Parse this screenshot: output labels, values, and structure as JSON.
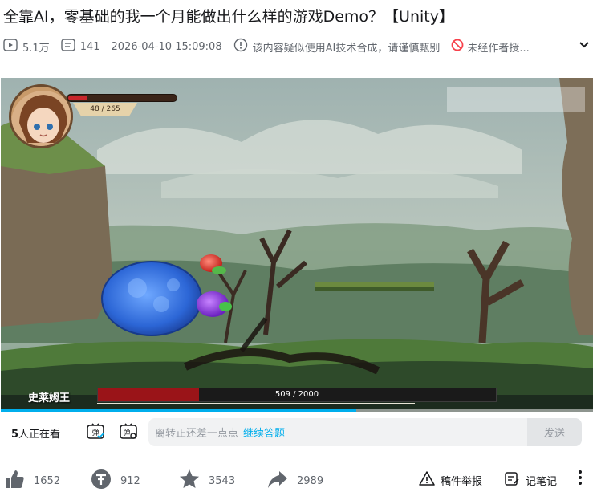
{
  "video": {
    "title": "全靠AI，零基础的我一个月能做出什么样的游戏Demo？【Unity】",
    "views": "5.1万",
    "danmaku_count": "141",
    "publish_time": "2026-04-10 15:09:08",
    "ai_notice": "该内容疑似使用AI技术合成，请谨慎甄别",
    "repost_notice": "未经作者授..."
  },
  "player": {
    "player_hp": {
      "current": 48,
      "max": 265,
      "text": "48 / 265"
    },
    "boss": {
      "name": "史莱姆王",
      "hp_current": 509,
      "hp_max": 2000,
      "hp_text": "509 / 2000"
    },
    "progress_fraction": 0.6
  },
  "danmaku_bar": {
    "viewers_count": "5",
    "viewers_suffix": "人正在看",
    "input_placeholder": "离转正还差一点点",
    "input_link": "继续答题",
    "send_label": "发送"
  },
  "actions": {
    "like": "1652",
    "coin": "912",
    "favorite": "3543",
    "share": "2989",
    "report": "稿件举报",
    "note": "记笔记"
  },
  "colors": {
    "accent": "#00aeec",
    "text_secondary": "#61666d",
    "boss_hp": "#9a1418",
    "player_hp": "#c8262b"
  }
}
